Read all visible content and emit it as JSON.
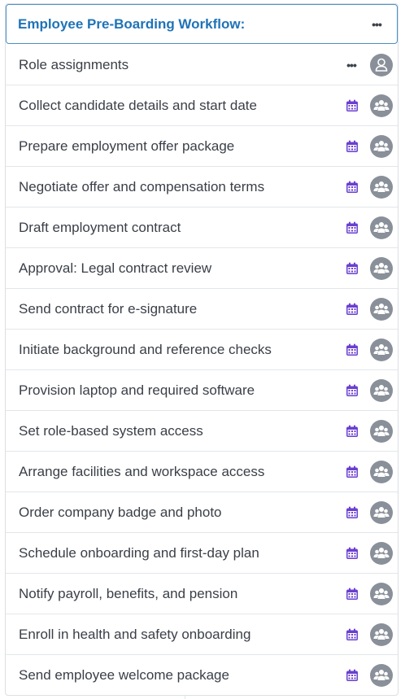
{
  "workflow": {
    "title": "Employee Pre-Boarding Workflow:",
    "menu_icon": "more-horizontal-icon"
  },
  "role_row": {
    "label": "Role assignments",
    "menu_icon": "more-horizontal-icon",
    "avatar_icon": "user-icon"
  },
  "tasks": [
    {
      "label": "Collect candidate details and start date"
    },
    {
      "label": "Prepare employment offer package"
    },
    {
      "label": "Negotiate offer and compensation terms"
    },
    {
      "label": "Draft employment contract"
    },
    {
      "label": "Approval: Legal contract review"
    },
    {
      "label": "Send contract for e-signature"
    },
    {
      "label": "Initiate background and reference checks"
    },
    {
      "label": "Provision laptop and required software"
    },
    {
      "label": "Set role-based system access"
    },
    {
      "label": "Arrange facilities and workspace access"
    },
    {
      "label": "Order company badge and photo"
    },
    {
      "label": "Schedule onboarding and first-day plan"
    },
    {
      "label": "Notify payroll, benefits, and pension"
    },
    {
      "label": "Enroll in health and safety onboarding"
    },
    {
      "label": "Send employee welcome package"
    }
  ],
  "icons": {
    "task_date": "calendar-icon",
    "task_assignee": "group-icon"
  },
  "colors": {
    "title": "#1f73b7",
    "header_border": "#4a90c4",
    "calendar": "#6a3fd0",
    "avatar": "#8a9099"
  }
}
